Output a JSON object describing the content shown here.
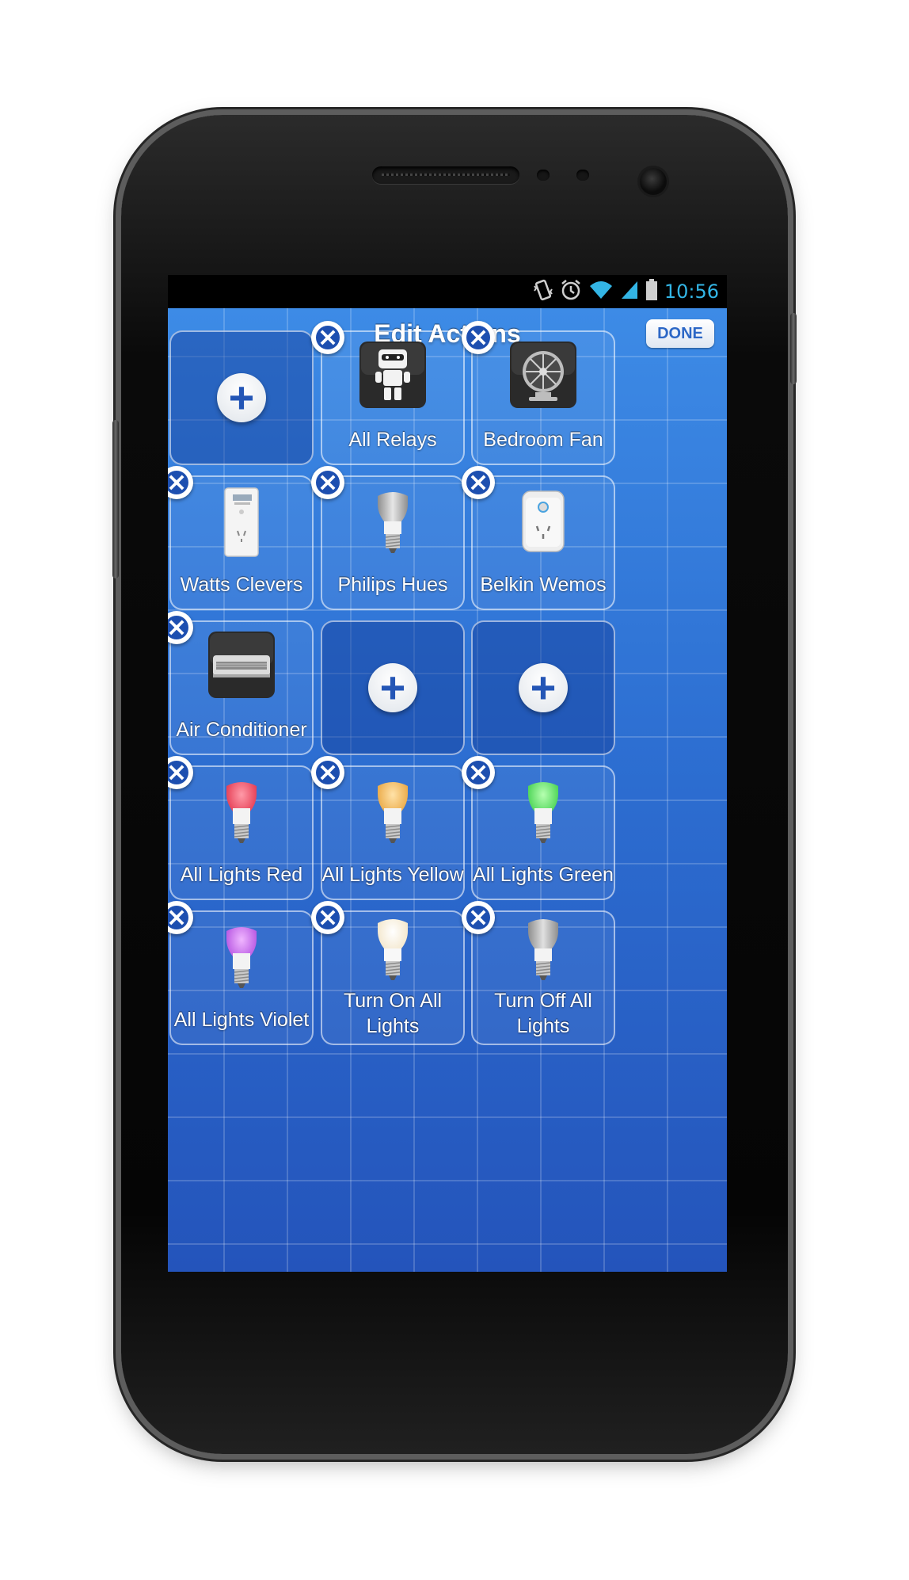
{
  "status_bar": {
    "time": "10:56",
    "icons": [
      "vibrate-icon",
      "alarm-icon",
      "wifi-icon",
      "signal-icon",
      "battery-icon"
    ]
  },
  "header": {
    "title": "Edit Actions",
    "done_label": "DONE"
  },
  "colors": {
    "accent": "#2c67c6",
    "status_text": "#33b5e5",
    "background_top": "#3d8be6",
    "background_bottom": "#2454bb"
  },
  "tiles": [
    {
      "label": "",
      "icon": "add-icon",
      "removable": false
    },
    {
      "label": "All Relays",
      "icon": "robot-icon",
      "removable": true
    },
    {
      "label": "Bedroom Fan",
      "icon": "fan-icon",
      "removable": true
    },
    {
      "label": "Watts Clevers",
      "icon": "smart-plug-icon",
      "removable": true
    },
    {
      "label": "Philips Hues",
      "icon": "bulb-icon",
      "removable": true
    },
    {
      "label": "Belkin Wemos",
      "icon": "wemo-switch-icon",
      "removable": true
    },
    {
      "label": "Air Conditioner",
      "icon": "air-conditioner-icon",
      "removable": true
    },
    {
      "label": "",
      "icon": "add-icon",
      "removable": false
    },
    {
      "label": "",
      "icon": "add-icon",
      "removable": false
    },
    {
      "label": "All Lights Red",
      "icon": "bulb-red-icon",
      "removable": true
    },
    {
      "label": "All Lights Yellow",
      "icon": "bulb-yellow-icon",
      "removable": true
    },
    {
      "label": "All Lights Green",
      "icon": "bulb-green-icon",
      "removable": true
    },
    {
      "label": "All Lights Violet",
      "icon": "bulb-violet-icon",
      "removable": true
    },
    {
      "label": "Turn On All Lights",
      "icon": "bulb-white-icon",
      "removable": true
    },
    {
      "label": "Turn Off All Lights",
      "icon": "bulb-off-icon",
      "removable": true
    }
  ]
}
